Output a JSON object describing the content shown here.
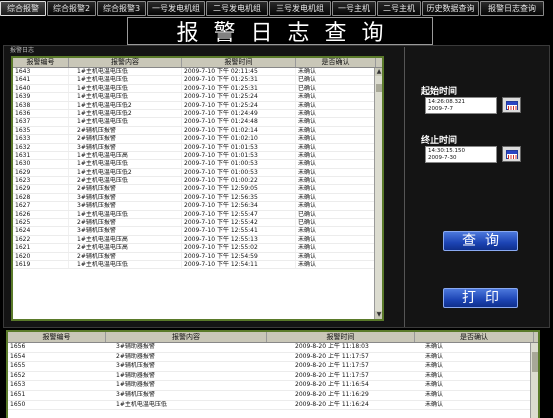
{
  "tabs": [
    {
      "label": "综合报警",
      "active": true
    },
    {
      "label": "综合报警2",
      "active": false
    },
    {
      "label": "综合报警3",
      "active": false
    },
    {
      "label": "一号发电机组",
      "active": false
    },
    {
      "label": "二号发电机组",
      "active": false
    },
    {
      "label": "三号发电机组",
      "active": false
    },
    {
      "label": "一号主机",
      "active": false
    },
    {
      "label": "二号主机",
      "active": false
    },
    {
      "label": "历史数据查询",
      "active": false
    },
    {
      "label": "报警日志查询",
      "active": false
    }
  ],
  "title": "报警日志查询",
  "frame_label": "报警日志",
  "log_table": {
    "columns": [
      "报警编号",
      "报警内容",
      "报警时间",
      "是否确认"
    ],
    "rows": [
      [
        "1643",
        "1#主机电温电压低",
        "2009-7-10 下午 02:11:45",
        "未确认"
      ],
      [
        "1641",
        "1#主机电温电压低",
        "2009-7-10 下午 01:25:31",
        "已确认"
      ],
      [
        "1640",
        "1#主机电温电压低",
        "2009-7-10 下午 01:25:31",
        "已确认"
      ],
      [
        "1639",
        "1#主机电温电压低",
        "2009-7-10 下午 01:25:24",
        "未确认"
      ],
      [
        "1638",
        "1#主机电温电压低2",
        "2009-7-10 下午 01:25:24",
        "未确认"
      ],
      [
        "1636",
        "1#主机电温电压低2",
        "2009-7-10 下午 01:24:49",
        "未确认"
      ],
      [
        "1637",
        "1#主机电温电压低",
        "2009-7-10 下午 01:24:48",
        "未确认"
      ],
      [
        "1635",
        "2#辅机压报警",
        "2009-7-10 下午 01:02:14",
        "未确认"
      ],
      [
        "1633",
        "2#辅机压报警",
        "2009-7-10 下午 01:02:10",
        "未确认"
      ],
      [
        "1632",
        "3#辅机压报警",
        "2009-7-10 下午 01:01:53",
        "未确认"
      ],
      [
        "1631",
        "1#主机电温电压高",
        "2009-7-10 下午 01:01:53",
        "未确认"
      ],
      [
        "1630",
        "1#主机电温电压低",
        "2009-7-10 下午 01:00:53",
        "未确认"
      ],
      [
        "1629",
        "1#主机电温电压低2",
        "2009-7-10 下午 01:00:53",
        "未确认"
      ],
      [
        "1623",
        "2#主机电温电压低",
        "2009-7-10 下午 01:00:22",
        "未确认"
      ],
      [
        "1629",
        "2#辅机压报警",
        "2009-7-10 下午 12:59:05",
        "未确认"
      ],
      [
        "1628",
        "3#辅机压报警",
        "2009-7-10 下午 12:56:35",
        "未确认"
      ],
      [
        "1627",
        "3#辅机压报警",
        "2009-7-10 下午 12:56:34",
        "未确认"
      ],
      [
        "1626",
        "1#主机电温电压低",
        "2009-7-10 下午 12:55:47",
        "已确认"
      ],
      [
        "1625",
        "2#辅机压报警",
        "2009-7-10 下午 12:55:42",
        "已确认"
      ],
      [
        "1624",
        "3#辅机压报警",
        "2009-7-10 下午 12:55:41",
        "未确认"
      ],
      [
        "1622",
        "1#主机电温电压高",
        "2009-7-10 下午 12:55:13",
        "未确认"
      ],
      [
        "1621",
        "2#主机电温电压高",
        "2009-7-10 下午 12:55:02",
        "未确认"
      ],
      [
        "1620",
        "2#辅机压报警",
        "2009-7-10 下午 12:54:59",
        "未确认"
      ],
      [
        "1619",
        "1#主机电温电压低",
        "2009-7-10 下午 12:54:11",
        "未确认"
      ]
    ]
  },
  "start_time": {
    "label": "起始时间",
    "time": "14:26:08.321",
    "date": "2009-7-7"
  },
  "end_time": {
    "label": "终止时间",
    "time": "14:30:15.150",
    "date": "2009-7-30"
  },
  "buttons": {
    "query": "查询",
    "print": "打印"
  },
  "bottom_table": {
    "columns": [
      "报警编号",
      "报警内容",
      "报警时间",
      "是否确认"
    ],
    "rows": [
      [
        "1656",
        "3#辅助器报警",
        "2009-8-20 上午 11:18:03",
        "未确认"
      ],
      [
        "1654",
        "2#辅助器报警",
        "2009-8-20 上午 11:17:57",
        "未确认"
      ],
      [
        "1655",
        "3#辅机压报警",
        "2009-8-20 上午 11:17:57",
        "未确认"
      ],
      [
        "1652",
        "1#辅助器报警",
        "2009-8-20 上午 11:17:57",
        "未确认"
      ],
      [
        "1653",
        "1#辅助器报警",
        "2009-8-20 上午 11:16:54",
        "未确认"
      ],
      [
        "1651",
        "3#辅机压报警",
        "2009-8-20 上午 11:16:29",
        "未确认"
      ],
      [
        "1650",
        "1#主机电温电压低",
        "2009-8-20 上午 11:16:24",
        "未确认"
      ]
    ]
  }
}
